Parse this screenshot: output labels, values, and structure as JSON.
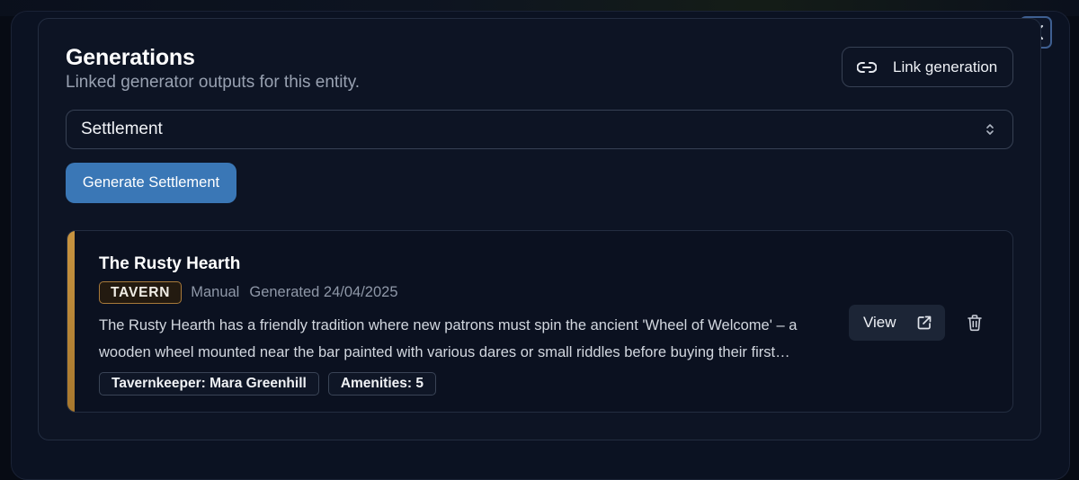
{
  "dialog": {
    "title": "Generations",
    "subtitle": "Linked generator outputs for this entity.",
    "close_icon": "close-icon"
  },
  "link_button": {
    "label": "Link generation",
    "icon": "link-icon"
  },
  "generator_select": {
    "value": "Settlement",
    "icon": "chevron-up-down-icon"
  },
  "generate_button": {
    "label": "Generate Settlement"
  },
  "generations": [
    {
      "title": "The Rusty Hearth",
      "type_badge": "TAVERN",
      "source": "Manual",
      "generated": "Generated 24/04/2025",
      "description_lines": [
        "The Rusty Hearth has a friendly tradition where new patrons must spin the ancient 'Wheel of Welcome' – a",
        "wooden wheel mounted near the bar painted with various dares or small riddles before buying their first…"
      ],
      "tags": [
        "Tavernkeeper: Mara Greenhill",
        "Amenities: 5"
      ],
      "view_label": "View",
      "view_icon": "external-link-icon",
      "delete_icon": "trash-icon",
      "accent_color": "#c89440"
    }
  ],
  "colors": {
    "primary": "#3a77b6",
    "background": "#0b1222",
    "badge_border": "#a87a3a"
  }
}
